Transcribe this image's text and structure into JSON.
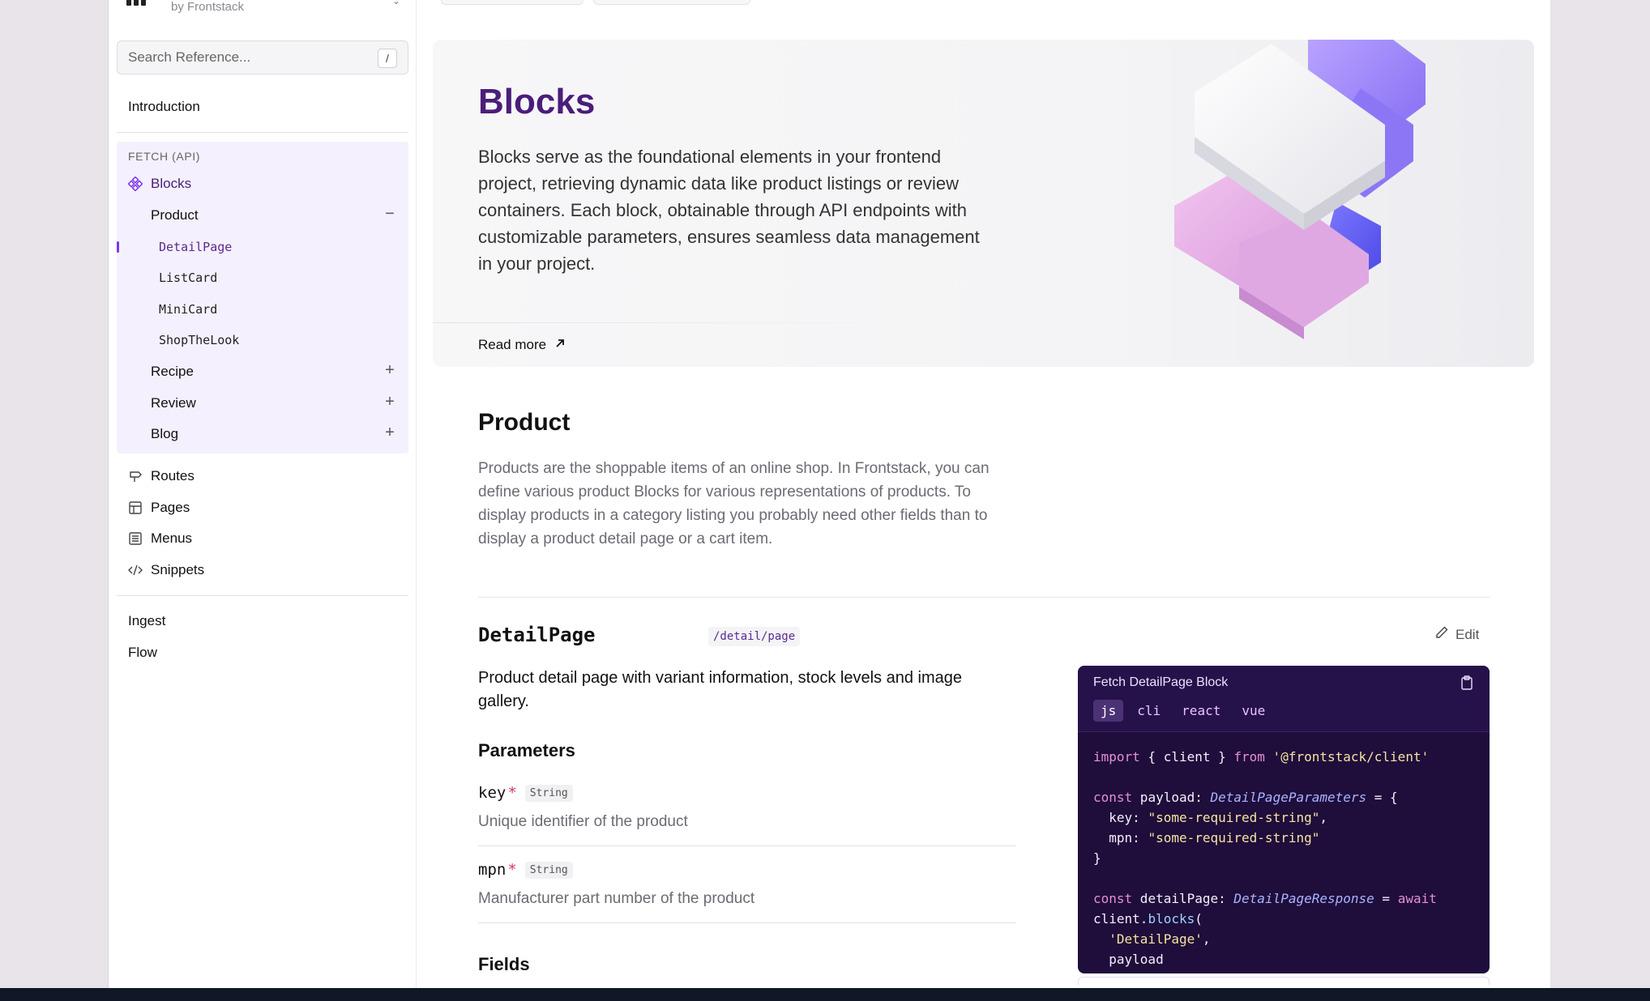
{
  "brand": {
    "by": "by Frontstack"
  },
  "search": {
    "placeholder": "Search Reference...",
    "shortcut": "/"
  },
  "sidebar": {
    "introduction": "Introduction",
    "group_label": "FETCH (API)",
    "blocks": "Blocks",
    "product": "Product",
    "product_leaves": [
      "DetailPage",
      "ListCard",
      "MiniCard",
      "ShopTheLook"
    ],
    "recipe": "Recipe",
    "review": "Review",
    "blog": "Blog",
    "routes": "Routes",
    "pages": "Pages",
    "menus": "Menus",
    "snippets": "Snippets",
    "ingest": "Ingest",
    "flow": "Flow",
    "collapse_symbol": "−",
    "expand_symbol": "+"
  },
  "hero": {
    "title": "Blocks",
    "description": "Blocks serve as the foundational elements in your frontend project, retrieving dynamic data like product listings or review containers. Each block, obtainable through API endpoints with customizable parameters, ensures seamless data management in your project.",
    "read_more": "Read more",
    "read_more_icon": "arrow-up-right-icon"
  },
  "section": {
    "title": "Product",
    "description": "Products are the shoppable items of an online shop. In Frontstack, you can define various product Blocks for various representations of products. To display products in a category listing you probably need other fields than to display a product detail page or a cart item."
  },
  "block": {
    "name": "DetailPage",
    "path": "/detail/page",
    "edit_label": "Edit",
    "description": "Product detail page with variant information, stock levels and image gallery.",
    "parameters_title": "Parameters",
    "parameters": [
      {
        "name": "key",
        "required": "*",
        "type": "String",
        "description": "Unique identifier of the product"
      },
      {
        "name": "mpn",
        "required": "*",
        "type": "String",
        "description": "Manufacturer part number of the product"
      }
    ],
    "fields_title": "Fields"
  },
  "code_panel": {
    "title": "Fetch DetailPage Block",
    "tabs": [
      "js",
      "cli",
      "react",
      "vue"
    ],
    "active_tab": "js",
    "lines": {
      "l1_kw1": "import",
      "l1_mid": " { client } ",
      "l1_kw2": "from",
      "l1_str": " '@frontstack/client'",
      "l2_kw": "const",
      "l2_name": " payload: ",
      "l2_type": "DetailPageParameters",
      "l2_eq": " = {",
      "l3_key": "  key: ",
      "l3_val": "\"some-required-string\"",
      "l3_end": ",",
      "l4_key": "  mpn: ",
      "l4_val": "\"some-required-string\"",
      "l5": "}",
      "l6_kw": "const",
      "l6_name": " detailPage: ",
      "l6_type": "DetailPageResponse",
      "l6_eq": " = ",
      "l6_await": "await",
      "l7_obj": "client.",
      "l7_fn": "blocks",
      "l7_paren": "(",
      "l8_str": "  'DetailPage'",
      "l8_end": ",",
      "l9": "  payload"
    }
  },
  "colors": {
    "accent": "#4a1d7a",
    "code_bg": "#1f0d3b",
    "sidebar_group_bg": "#f4f0fd"
  }
}
